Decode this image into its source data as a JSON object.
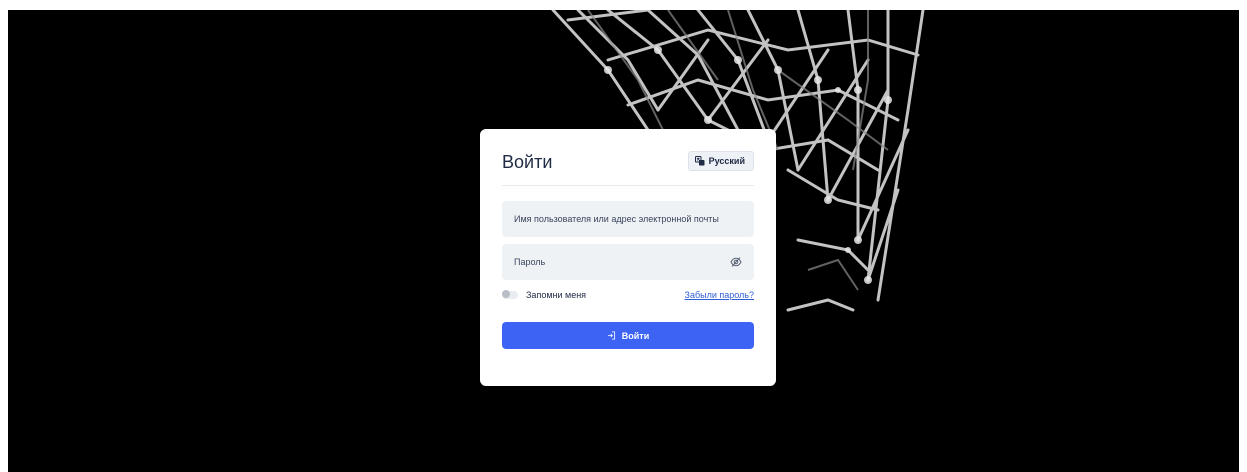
{
  "login": {
    "title": "Войти",
    "language_label": "Русский",
    "username_placeholder": "Имя пользователя или адрес электронной почты",
    "password_placeholder": "Пароль",
    "remember_label": "Запомни меня",
    "remember_checked": false,
    "forgot_label": "Забыли пароль?",
    "submit_label": "Войти"
  },
  "icons": {
    "language": "language-icon",
    "password_visibility": "eye-off-icon",
    "submit": "login-icon"
  },
  "colors": {
    "background": "#000000",
    "card": "#ffffff",
    "field": "#eff2f5",
    "accent": "#3d63f5",
    "link": "#2f5ed8",
    "text": "#1f2a44"
  }
}
